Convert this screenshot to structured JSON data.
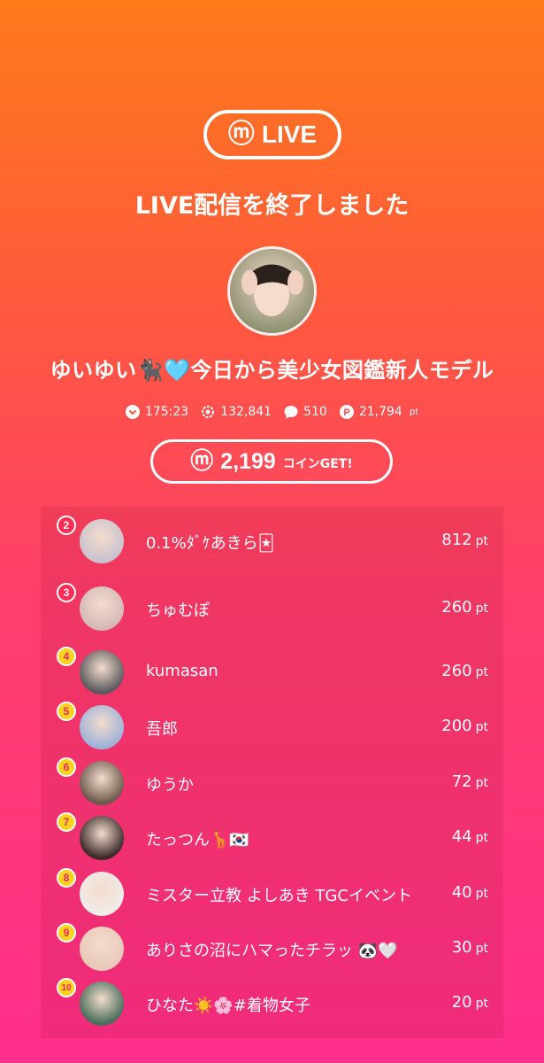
{
  "header": {
    "logo_text": "LIVE",
    "headline": "LIVE配信を終了しました"
  },
  "streamer": {
    "name": "ゆいゆい🐈‍⬛🩵今日から美少女図鑑新人モデル"
  },
  "stats": {
    "duration": "175:23",
    "viewers": "132,841",
    "comments": "510",
    "points": "21,794",
    "points_unit": "pt"
  },
  "coins": {
    "amount": "2,199",
    "label": "コインGET!"
  },
  "ranking": [
    {
      "rank": "2",
      "name": "0.1%ﾀﾞｹあきら🃏",
      "points": "812",
      "unit": "pt",
      "avatar_color": "#c9c3cf"
    },
    {
      "rank": "3",
      "name": "ちゅむぽ",
      "points": "260",
      "unit": "pt",
      "avatar_color": "#d7b8b8"
    },
    {
      "rank": "4",
      "name": "kumasan",
      "points": "260",
      "unit": "pt",
      "avatar_color": "#5b5b5e"
    },
    {
      "rank": "5",
      "name": "吾郎",
      "points": "200",
      "unit": "pt",
      "avatar_color": "#9fb3d9"
    },
    {
      "rank": "6",
      "name": "ゆうか",
      "points": "72",
      "unit": "pt",
      "avatar_color": "#6e5a4c"
    },
    {
      "rank": "7",
      "name": "たっつん🦒🇰🇷",
      "points": "44",
      "unit": "pt",
      "avatar_color": "#3c2a2a"
    },
    {
      "rank": "8",
      "name": "ミスター立教 よしあき TGCイベント",
      "points": "40",
      "unit": "pt",
      "avatar_color": "#f0ece8"
    },
    {
      "rank": "9",
      "name": "ありさの沼にハマったチラッ 🐼🤍",
      "points": "30",
      "unit": "pt",
      "avatar_color": "#e8c9b8"
    },
    {
      "rank": "10",
      "name": "ひなた☀️🌸#着物女子",
      "points": "20",
      "unit": "pt",
      "avatar_color": "#4a6e5a"
    }
  ],
  "colors": {
    "gradient_top": "#ff7a1a",
    "gradient_bottom": "#ff2f8c",
    "badge_gold": "#ffd21e",
    "badge_red": "#ff2d55"
  }
}
